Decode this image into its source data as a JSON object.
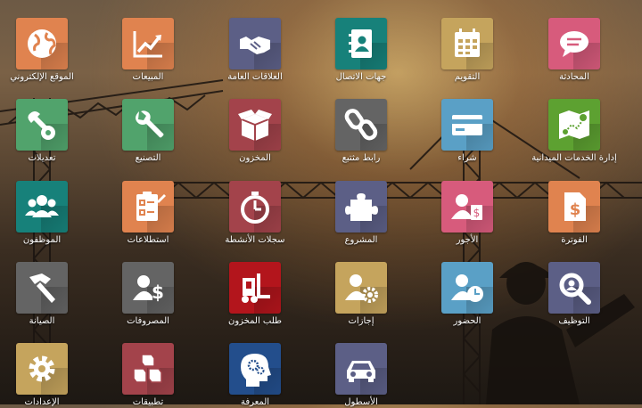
{
  "apps": [
    {
      "label": "الموقع الإلكتروني",
      "color": "#e0834f",
      "icon": "globe-icon"
    },
    {
      "label": "المبيعات",
      "color": "#e0834f",
      "icon": "chart-up-icon"
    },
    {
      "label": "العلاقات العامة",
      "color": "#5c5f86",
      "icon": "handshake-icon"
    },
    {
      "label": "جهات الاتصال",
      "color": "#17817a",
      "icon": "address-book-icon"
    },
    {
      "label": "التقويم",
      "color": "#c5a45d",
      "icon": "calendar-icon"
    },
    {
      "label": "المحادثة",
      "color": "#d75b7c",
      "icon": "chat-icon"
    },
    {
      "label": "تعديلات",
      "color": "#51a36c",
      "icon": "tools-icon"
    },
    {
      "label": "التصنيع",
      "color": "#51a36c",
      "icon": "wrench-icon"
    },
    {
      "label": "المخزون",
      "color": "#a3434b",
      "icon": "box-icon"
    },
    {
      "label": "رابط مثتبع",
      "color": "#646464",
      "icon": "link-icon"
    },
    {
      "label": "شراء",
      "color": "#5aa0c6",
      "icon": "credit-card-icon"
    },
    {
      "label": "إدارة الخدمات الميدانية",
      "color": "#5da131",
      "icon": "map-pin-icon"
    },
    {
      "label": "الموظفون",
      "color": "#17817a",
      "icon": "users-icon"
    },
    {
      "label": "استطلاعات",
      "color": "#e0834f",
      "icon": "survey-icon"
    },
    {
      "label": "سجلات الأنشطة",
      "color": "#a3434b",
      "icon": "stopwatch-icon"
    },
    {
      "label": "المشروع",
      "color": "#5c5f86",
      "icon": "puzzle-icon"
    },
    {
      "label": "الأجور",
      "color": "#d75b7c",
      "icon": "payroll-icon"
    },
    {
      "label": "الفوترة",
      "color": "#e0834f",
      "icon": "invoice-icon"
    },
    {
      "label": "الصيانة",
      "color": "#646464",
      "icon": "hammer-icon"
    },
    {
      "label": "المصروفات",
      "color": "#646464",
      "icon": "expense-icon"
    },
    {
      "label": "طلب المخزون",
      "color": "#b3151c",
      "icon": "forklift-icon"
    },
    {
      "label": "إجازات",
      "color": "#c5a45d",
      "icon": "user-gear-icon"
    },
    {
      "label": "الحضور",
      "color": "#5aa0c6",
      "icon": "user-clock-icon"
    },
    {
      "label": "التوظيف",
      "color": "#5c5f86",
      "icon": "magnifier-icon"
    },
    {
      "label": "الإعدادات",
      "color": "#c5a45d",
      "icon": "gear-icon"
    },
    {
      "label": "تطبيقات",
      "color": "#a3434b",
      "icon": "cubes-icon"
    },
    {
      "label": "المعرفة",
      "color": "#234e8c",
      "icon": "brain-head-icon"
    },
    {
      "label": "الأسطول",
      "color": "#5c5f86",
      "icon": "car-icon"
    }
  ]
}
